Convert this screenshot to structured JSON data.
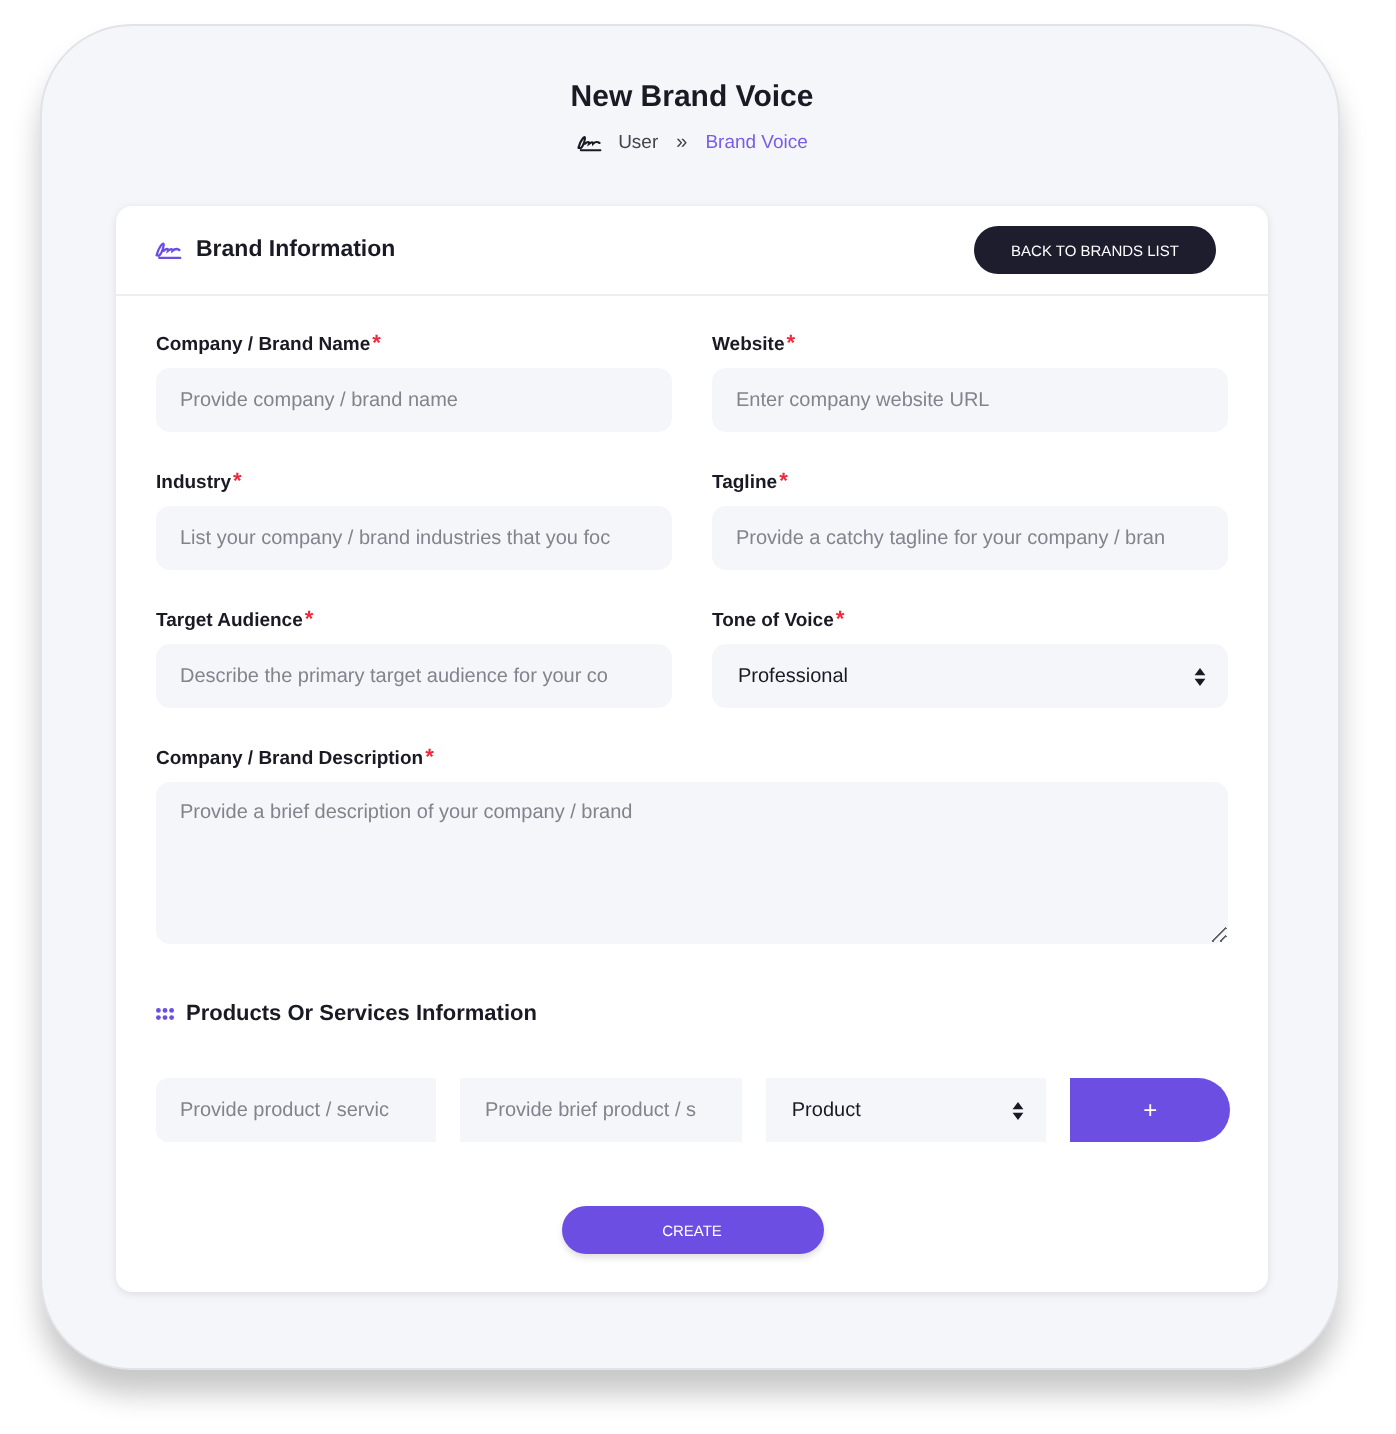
{
  "page": {
    "title": "New Brand Voice",
    "breadcrumb_separator": "»",
    "breadcrumb": [
      {
        "label": "User",
        "selected": false
      },
      {
        "label": "Brand Voice",
        "selected": true
      }
    ]
  },
  "brand_information": {
    "title": "Brand Information",
    "back_button": "BACK TO BRANDS LIST",
    "fields": [
      {
        "kind": "input",
        "label": "Company / Brand Name",
        "required_mark": "*",
        "placeholder": "Provide company / brand name"
      },
      {
        "kind": "input",
        "label": "Website",
        "required_mark": "*",
        "placeholder": "Enter company website URL"
      },
      {
        "kind": "input",
        "label": "Industry",
        "required_mark": "*",
        "placeholder": "List your company / brand industries that you foc"
      },
      {
        "kind": "input",
        "label": "Tagline",
        "required_mark": "*",
        "placeholder": "Provide a catchy tagline for your company / bran"
      },
      {
        "kind": "input",
        "label": "Target Audience",
        "required_mark": "*",
        "placeholder": "Describe the primary target audience for your co"
      },
      {
        "kind": "select",
        "label": "Tone of Voice",
        "required_mark": "*",
        "value": "Professional"
      },
      {
        "kind": "textarea",
        "label": "Company / Brand Description",
        "required_mark": "*",
        "placeholder": "Provide a brief description of your company / brand"
      }
    ]
  },
  "products_information": {
    "title": "Products Or Services Information",
    "fields": [
      {
        "kind": "input",
        "placeholder": "Provide product / servic"
      },
      {
        "kind": "input",
        "placeholder": "Provide brief product / s"
      },
      {
        "kind": "select",
        "value": "Product"
      }
    ],
    "add_button": "+"
  },
  "create_button": "CREATE"
}
